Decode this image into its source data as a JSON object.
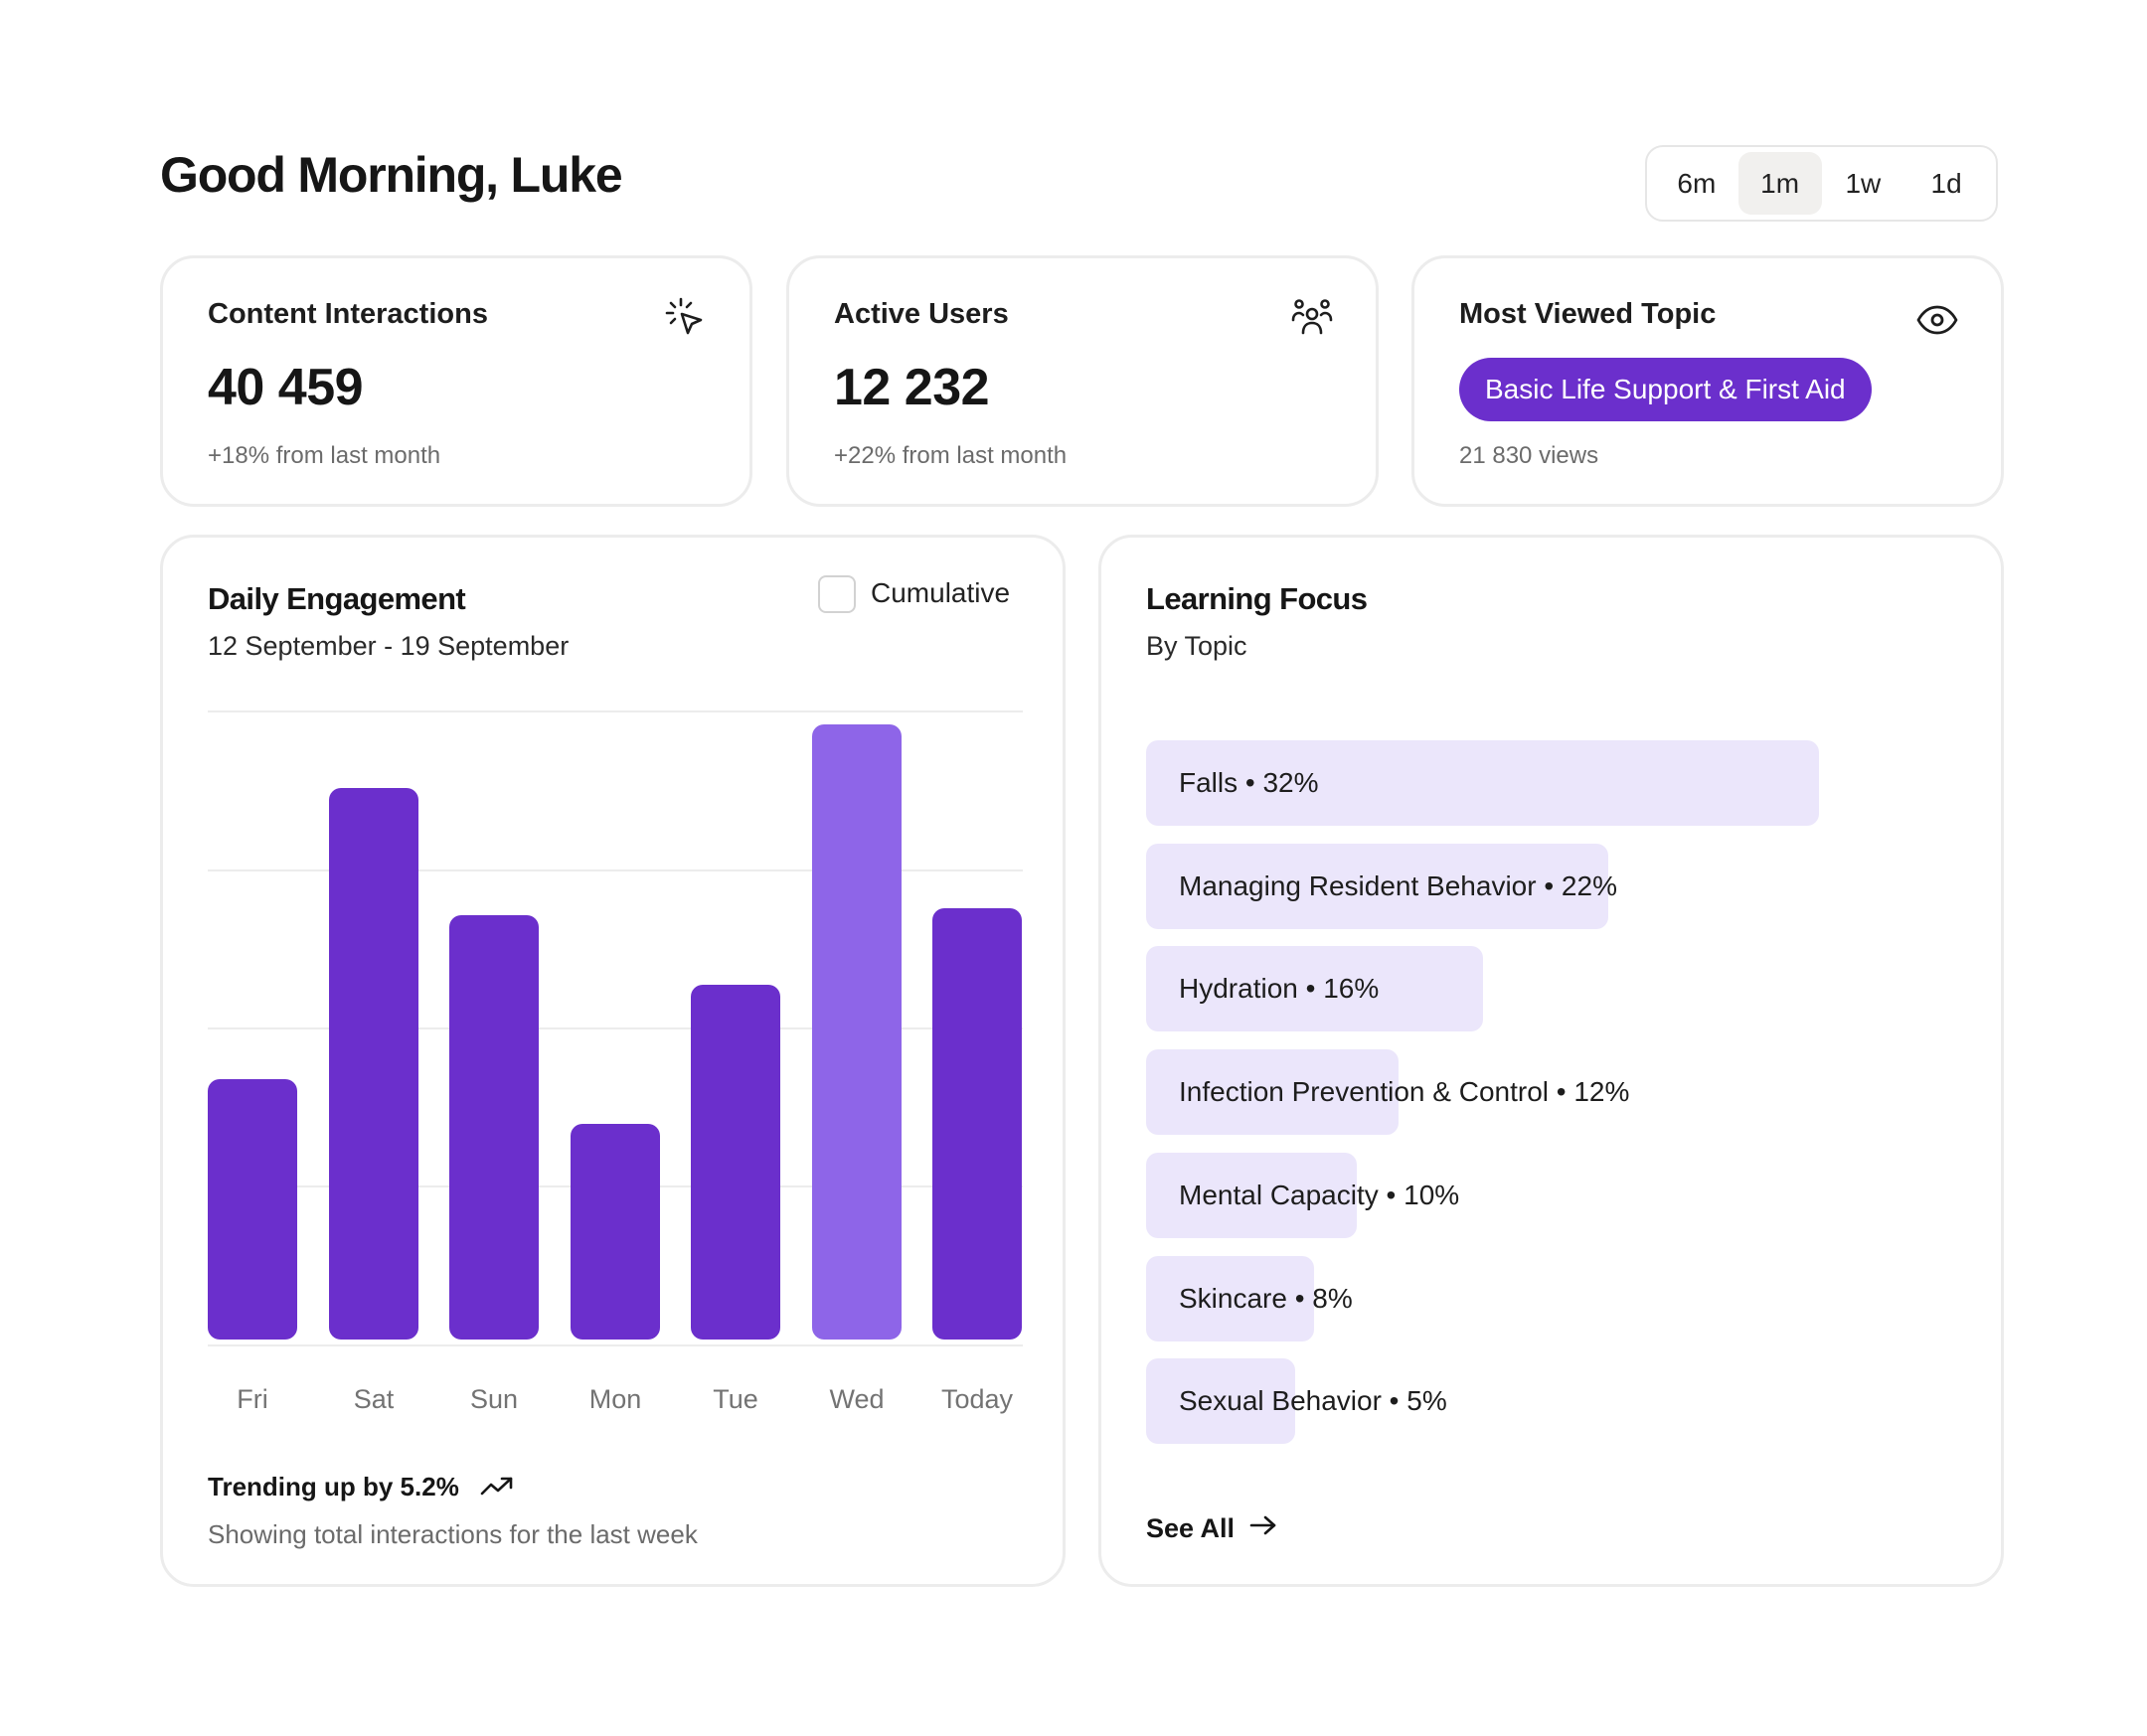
{
  "header": {
    "greeting": "Good Morning, Luke",
    "ranges": [
      "6m",
      "1m",
      "1w",
      "1d"
    ],
    "active_range": "1m"
  },
  "stats": {
    "interactions": {
      "label": "Content Interactions",
      "value": "40 459",
      "sub": "+18% from last month",
      "icon": "cursor-click-icon"
    },
    "users": {
      "label": "Active Users",
      "value": "12 232",
      "sub": "+22% from last month",
      "icon": "users-icon"
    },
    "topic": {
      "label": "Most Viewed Topic",
      "pill": "Basic Life Support & First Aid",
      "sub": "21 830 views",
      "icon": "eye-icon"
    }
  },
  "engagement": {
    "title": "Daily Engagement",
    "date_range": "12 September - 19 September",
    "cumulative_label": "Cumulative",
    "cumulative_checked": false,
    "trend": "Trending up by 5.2%",
    "trend_icon": "trending-up-icon",
    "trend_sub": "Showing total interactions for the last week"
  },
  "chart_data": {
    "type": "bar",
    "categories": [
      "Fri",
      "Sat",
      "Sun",
      "Mon",
      "Tue",
      "Wed",
      "Today"
    ],
    "values": [
      0.41,
      0.87,
      0.67,
      0.34,
      0.56,
      0.97,
      0.68
    ],
    "highlight": "Wed",
    "colors": {
      "bar": "#6b2fcc",
      "highlight": "#8e65e8"
    },
    "ylim": [
      0,
      1
    ],
    "grid": true
  },
  "focus": {
    "title": "Learning Focus",
    "subtitle": "By Topic",
    "see_all": "See All",
    "topics": [
      {
        "label": "Falls • 32%",
        "pct": 32
      },
      {
        "label": "Managing Resident Behavior • 22%",
        "pct": 22
      },
      {
        "label": "Hydration • 16%",
        "pct": 16
      },
      {
        "label": "Infection Prevention & Control • 12%",
        "pct": 12
      },
      {
        "label": "Mental Capacity • 10%",
        "pct": 10
      },
      {
        "label": "Skincare • 8%",
        "pct": 8
      },
      {
        "label": "Sexual Behavior • 5%",
        "pct": 5
      }
    ]
  }
}
